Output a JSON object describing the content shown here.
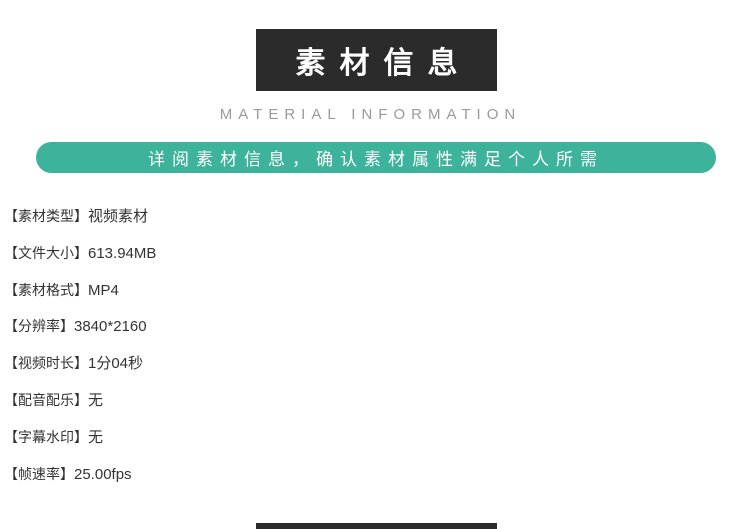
{
  "header": {
    "title": "素材信息",
    "subtitle": "MATERIAL INFORMATION",
    "banner": "详阅素材信息，确认素材属性满足个人所需"
  },
  "info": [
    {
      "label": "【素材类型】",
      "value": "视频素材"
    },
    {
      "label": "【文件大小】",
      "value": "613.94MB"
    },
    {
      "label": "【素材格式】",
      "value": "MP4"
    },
    {
      "label": "【分辨率】",
      "value": "3840*2160"
    },
    {
      "label": "【视频时长】",
      "value": "1分04秒"
    },
    {
      "label": "【配音配乐】",
      "value": "无"
    },
    {
      "label": "【字幕水印】",
      "value": "无"
    },
    {
      "label": "【帧速率】",
      "value": "25.00fps"
    }
  ],
  "colors": {
    "title_bg": "#2b2b2b",
    "banner_bg": "#3db39c",
    "subtitle_text": "#9a9a9a",
    "body_text": "#333333"
  }
}
